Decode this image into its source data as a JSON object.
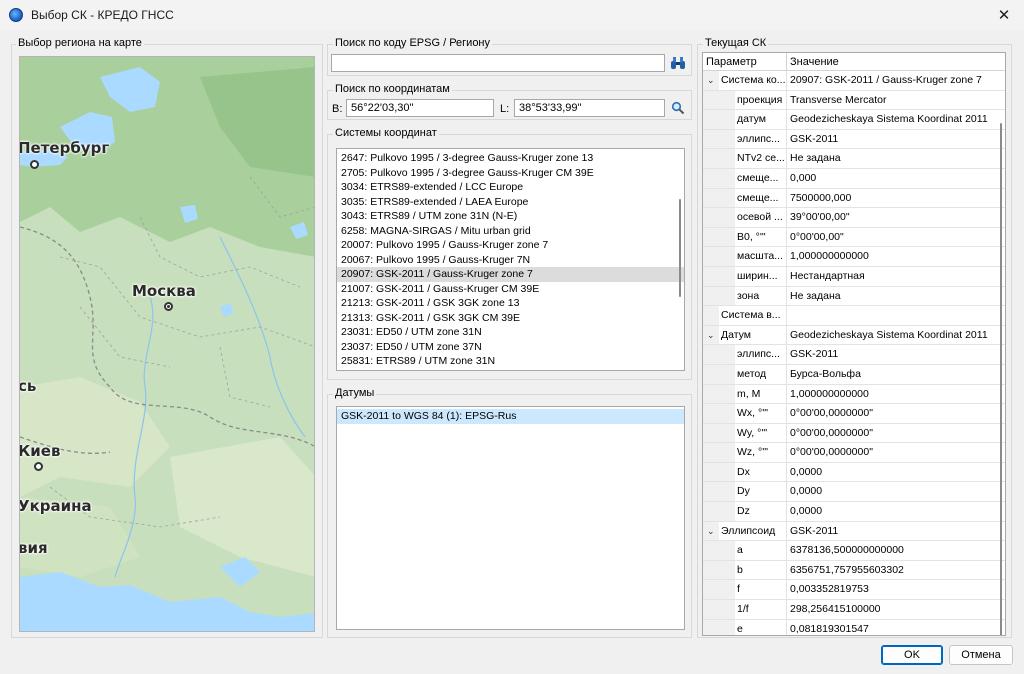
{
  "window": {
    "title": "Выбор СК - КРЕДО ГНСС",
    "close_symbol": "✕"
  },
  "map_panel": {
    "label": "Выбор региона на карте",
    "cities": [
      {
        "id": "peterburg",
        "name": "Петербург"
      },
      {
        "id": "moskva",
        "name": "Москва"
      },
      {
        "id": "kiev",
        "name": "Киев"
      }
    ],
    "region_labels": [
      "сь",
      "Украина",
      "вия"
    ]
  },
  "epsg_search": {
    "label": "Поиск по коду EPSG / Региону",
    "value": "",
    "icon": "binoculars-icon"
  },
  "coord_search": {
    "label": "Поиск по координатам",
    "b_label": "B:",
    "b_value": "56°22'03,30\"",
    "l_label": "L:",
    "l_value": "38°53'33,99\"",
    "icon": "search-icon"
  },
  "coord_systems": {
    "label": "Системы координат",
    "selected_index": 8,
    "items": [
      "2647: Pulkovo 1995 / 3-degree Gauss-Kruger zone 13",
      "2705: Pulkovo 1995 / 3-degree Gauss-Kruger CM 39E",
      "3034: ETRS89-extended / LCC Europe",
      "3035: ETRS89-extended / LAEA Europe",
      "3043: ETRS89 / UTM zone 31N (N-E)",
      "6258: MAGNA-SIRGAS / Mitu urban grid",
      "20007: Pulkovo 1995 / Gauss-Kruger zone 7",
      "20067: Pulkovo 1995 / Gauss-Kruger 7N",
      "20907: GSK-2011 / Gauss-Kruger zone 7",
      "21007: GSK-2011 / Gauss-Kruger CM 39E",
      "21213: GSK-2011 / GSK 3GK zone 13",
      "21313: GSK-2011 / GSK 3GK CM 39E",
      "23031: ED50 / UTM zone 31N",
      "23037: ED50 / UTM zone 37N",
      "25831: ETRS89 / UTM zone 31N"
    ]
  },
  "datums": {
    "label": "Датумы",
    "items": [
      "GSK-2011 to WGS 84 (1): EPSG-Rus"
    ]
  },
  "current_cs": {
    "label": "Текущая СК",
    "col_param": "Параметр",
    "col_value": "Значение",
    "rows": [
      {
        "level": 0,
        "expander": "⌄",
        "name": "Система ко...",
        "value": "20907: GSK-2011 / Gauss-Kruger zone 7"
      },
      {
        "level": 1,
        "name": "проекция",
        "value": "Transverse Mercator"
      },
      {
        "level": 1,
        "name": "датум",
        "value": "Geodezicheskaya Sistema Koordinat 2011"
      },
      {
        "level": 1,
        "name": "эллипс...",
        "value": "GSK-2011"
      },
      {
        "level": 1,
        "name": "NTv2 се...",
        "value": "Не задана"
      },
      {
        "level": 1,
        "name": "смеще...",
        "value": "0,000"
      },
      {
        "level": 1,
        "name": "смеще...",
        "value": "7500000,000"
      },
      {
        "level": 1,
        "name": "осевой ...",
        "value": " 39°00'00,00\""
      },
      {
        "level": 1,
        "name": "B0, °'\"",
        "value": "  0°00'00,00\""
      },
      {
        "level": 1,
        "name": "масшта...",
        "value": "1,000000000000"
      },
      {
        "level": 1,
        "name": "ширин...",
        "value": "Нестандартная"
      },
      {
        "level": 1,
        "name": "зона",
        "value": "Не задана"
      },
      {
        "level": 0,
        "name": "Система в...",
        "value": ""
      },
      {
        "level": 0,
        "expander": "⌄",
        "name": "Датум",
        "value": "Geodezicheskaya Sistema Koordinat 2011"
      },
      {
        "level": 1,
        "name": "эллипс...",
        "value": "GSK-2011"
      },
      {
        "level": 1,
        "name": "метод",
        "value": "Бурса-Вольфа"
      },
      {
        "level": 1,
        "name": "m, M",
        "value": "1,000000000000"
      },
      {
        "level": 1,
        "name": "Wx, °'\"",
        "value": "  0°00'00,0000000\""
      },
      {
        "level": 1,
        "name": "Wy, °'\"",
        "value": "  0°00'00,0000000\""
      },
      {
        "level": 1,
        "name": "Wz, °'\"",
        "value": "  0°00'00,0000000\""
      },
      {
        "level": 1,
        "name": "Dx",
        "value": "0,0000"
      },
      {
        "level": 1,
        "name": "Dy",
        "value": "0,0000"
      },
      {
        "level": 1,
        "name": "Dz",
        "value": "0,0000"
      },
      {
        "level": 0,
        "expander": "⌄",
        "name": "Эллипсоид",
        "value": "GSK-2011"
      },
      {
        "level": 1,
        "name": "a",
        "value": "6378136,500000000000"
      },
      {
        "level": 1,
        "name": "b",
        "value": "6356751,757955603302"
      },
      {
        "level": 1,
        "name": "f",
        "value": "0,003352819753"
      },
      {
        "level": 1,
        "name": "1/f",
        "value": "298,256415100000"
      },
      {
        "level": 1,
        "name": "e",
        "value": "0,081819301547"
      }
    ]
  },
  "buttons": {
    "ok": "OK",
    "cancel": "Отмена"
  },
  "colors": {
    "accent": "#0067c0",
    "selection": "#dcdcdc",
    "datum_selection": "#cce8ff",
    "map_land": "#c8dfbd",
    "map_water": "#aadaff"
  }
}
